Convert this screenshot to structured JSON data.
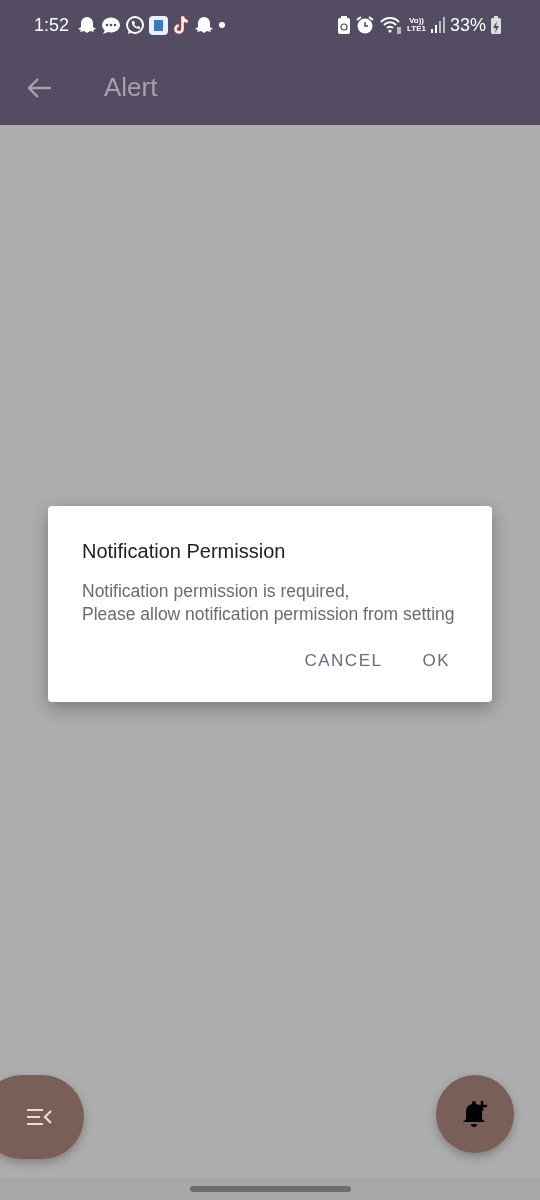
{
  "status_bar": {
    "time": "1:52",
    "network_top": "Vo))",
    "network_bottom": "LTE1",
    "battery": "33%"
  },
  "app_bar": {
    "title": "Alert"
  },
  "dialog": {
    "title": "Notification Permission",
    "message": "Notification permission is required,\nPlease allow notification permission from setting",
    "buttons": [
      "CANCEL",
      "OK"
    ]
  }
}
